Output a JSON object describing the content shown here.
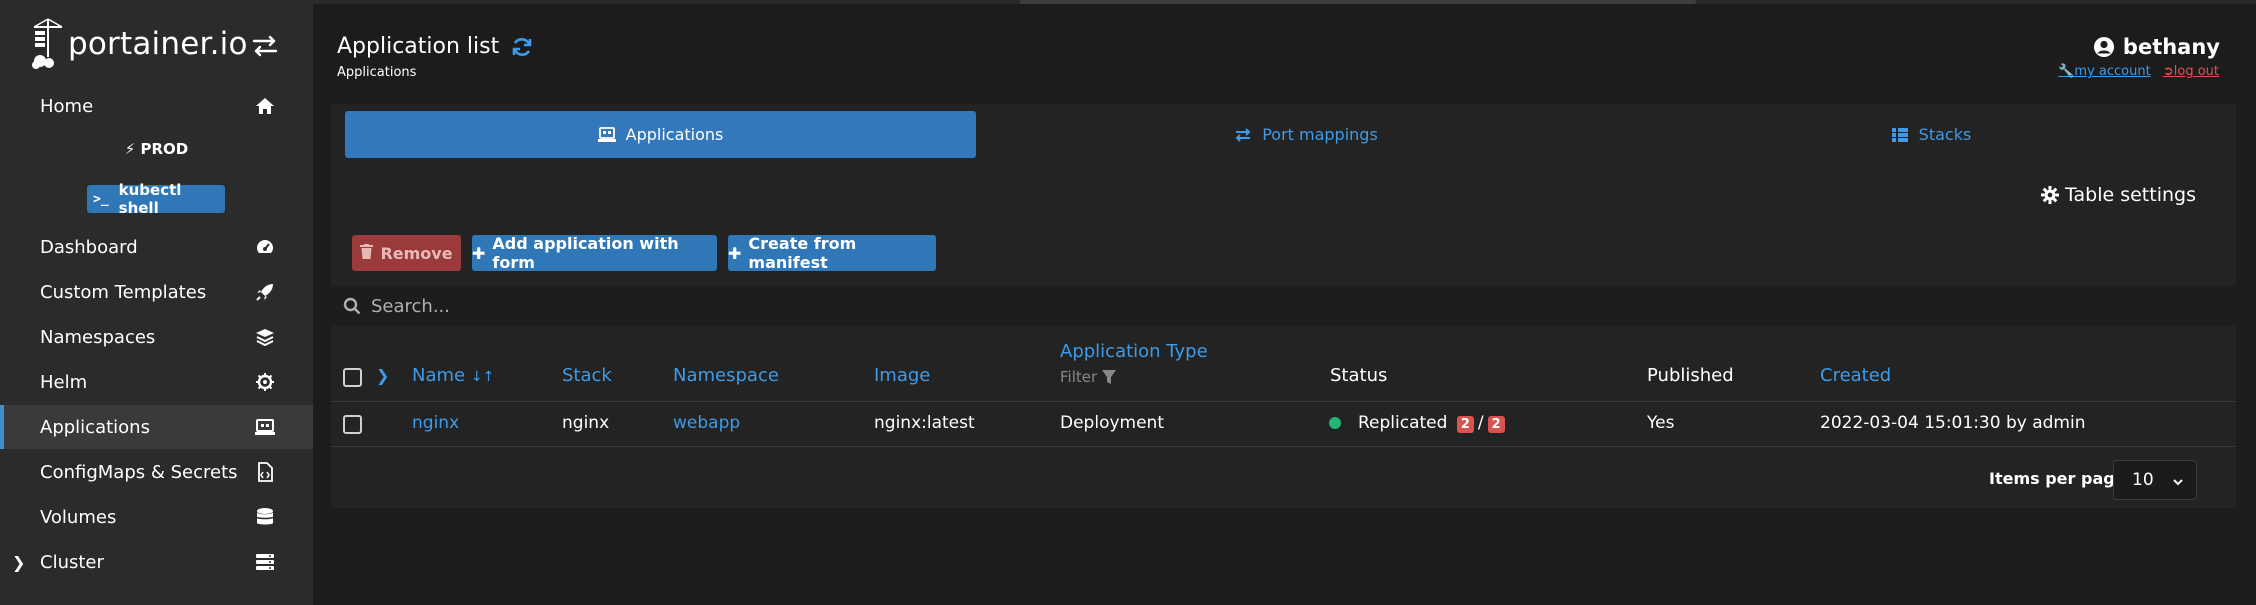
{
  "brand": {
    "name": "portainer.io"
  },
  "sidebar": {
    "environment": "PROD",
    "kubectl_label": "kubectl shell",
    "items": [
      {
        "label": "Home",
        "icon": "home-icon"
      },
      {
        "label": "Dashboard",
        "icon": "dashboard-icon"
      },
      {
        "label": "Custom Templates",
        "icon": "rocket-icon"
      },
      {
        "label": "Namespaces",
        "icon": "layers-icon"
      },
      {
        "label": "Helm",
        "icon": "helm-icon"
      },
      {
        "label": "Applications",
        "icon": "laptop-icon"
      },
      {
        "label": "ConfigMaps & Secrets",
        "icon": "file-code-icon"
      },
      {
        "label": "Volumes",
        "icon": "database-icon"
      },
      {
        "label": "Cluster",
        "icon": "server-icon"
      }
    ],
    "active": "Applications"
  },
  "header": {
    "title": "Application list",
    "subtitle": "Applications",
    "user": "bethany",
    "my_account": "my account",
    "log_out": "log out"
  },
  "tabs": [
    {
      "label": "Applications",
      "active": true
    },
    {
      "label": "Port mappings",
      "active": false
    },
    {
      "label": "Stacks",
      "active": false
    }
  ],
  "table_settings": "Table settings",
  "actions": {
    "remove": "Remove",
    "add_form": "Add application with form",
    "manifest": "Create from manifest"
  },
  "search": {
    "placeholder": "Search..."
  },
  "table": {
    "columns": {
      "name": "Name",
      "stack": "Stack",
      "namespace": "Namespace",
      "image": "Image",
      "app_type": "Application Type",
      "filter": "Filter",
      "status": "Status",
      "published": "Published",
      "created": "Created"
    },
    "rows": [
      {
        "name": "nginx",
        "stack": "nginx",
        "namespace": "webapp",
        "image": "nginx:latest",
        "app_type": "Deployment",
        "status_text": "Replicated",
        "replicas_ready": "2",
        "replicas_separator": "/",
        "replicas_total": "2",
        "published": "Yes",
        "created": "2022-03-04 15:01:30 by admin"
      }
    ]
  },
  "pagination": {
    "label": "Items per page",
    "value": "10"
  },
  "colors": {
    "accent": "#3d9be9",
    "primary": "#3378bb",
    "danger": "#d9534f",
    "status_ok": "#22b573"
  }
}
